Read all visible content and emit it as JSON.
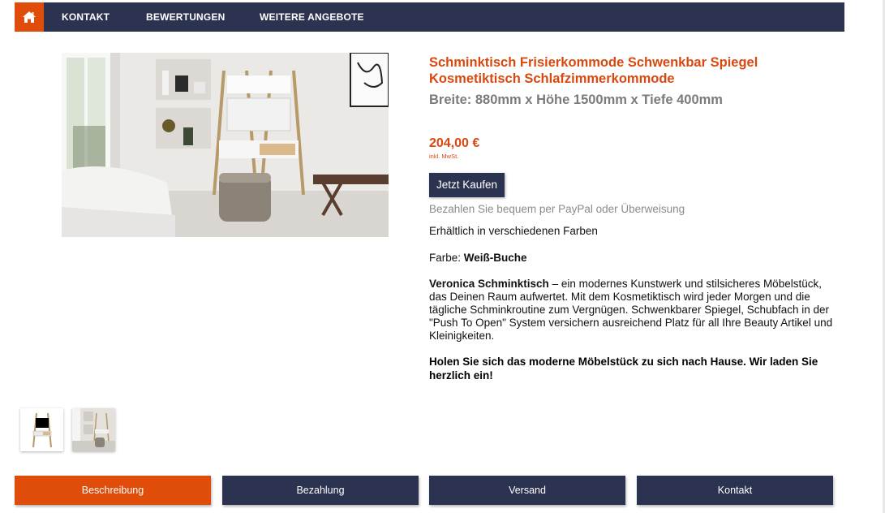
{
  "nav": {
    "home_icon": "home-icon",
    "items": [
      {
        "label": "KONTAKT"
      },
      {
        "label": "BEWERTUNGEN"
      },
      {
        "label": "WEITERE ANGEBOTE"
      }
    ]
  },
  "product": {
    "title": "Schminktisch Frisierkommode Schwenkbar Spiegel Kosmetiktisch Schlafzimmerkommode",
    "dimensions": "Breite: 880mm x Höhe 1500mm x Tiefe 400mm",
    "price": "204,00 €",
    "vat_note": "inkl. MwSt.",
    "buy_label": "Jetzt Kaufen",
    "payment_note": "Bezahlen Sie bequem per PayPal oder Überweisung",
    "availability": "Erhältlich in verschiedenen Farben",
    "color_label": "Farbe:",
    "color_value": "Weiß-Buche",
    "description_name": "Veronica Schminktisch",
    "description_text": " – ein modernes Kunstwerk und stilsicheres Möbelstück, das Deinen Raum aufwertet. Mit dem Kosmetiktisch wird jeder Morgen und die tägliche Schminkroutine zum Vergnügen. Schwenkbarer Spiegel, Schubfach in der \"Push To Open\" System versichern ausreichend Platz für all Ihre Beauty Artikel und Kleinigkeiten.",
    "closing": "Holen Sie sich das moderne Möbelstück zu sich nach Hause. Wir laden Sie herzlich ein!"
  },
  "tabs": [
    {
      "label": "Beschreibung",
      "active": true
    },
    {
      "label": "Bezahlung",
      "active": false
    },
    {
      "label": "Versand",
      "active": false
    },
    {
      "label": "Kontakt",
      "active": false
    }
  ],
  "colors": {
    "accent": "#e04d0a",
    "title": "#d9480f",
    "navy": "#2c3350"
  }
}
